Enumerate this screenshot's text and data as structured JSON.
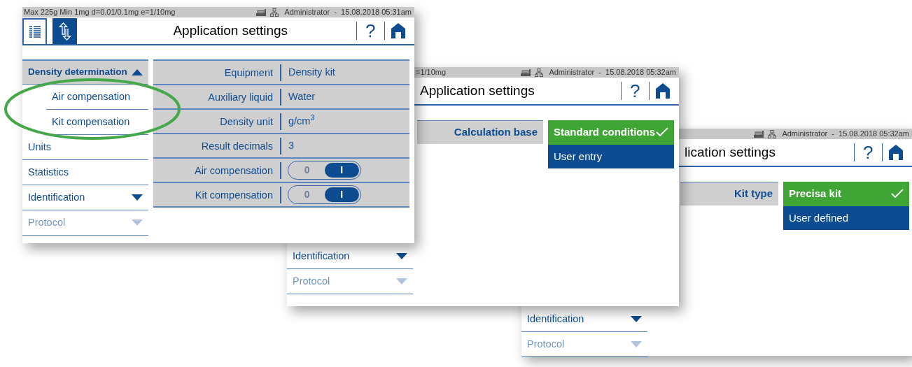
{
  "windows": [
    {
      "status_bar": {
        "scale_info": "Max 225g  Min 1mg  d=0.01/0.1mg  e=1/10mg",
        "user": "Administrator  -  15.08.2018 05:31am"
      },
      "header": {
        "tabs": [
          {
            "kind": "list",
            "selected": true
          },
          {
            "kind": "transfer",
            "selected": false
          }
        ],
        "title": "Application settings",
        "help": "?"
      },
      "sidebar": [
        {
          "label": "Density determination",
          "kind": "group",
          "selected": true,
          "expanded": true,
          "children": [
            {
              "label": "Air compensation"
            },
            {
              "label": "Kit compensation"
            }
          ]
        },
        {
          "label": "Units",
          "kind": "item",
          "selected": false
        },
        {
          "label": "Statistics",
          "kind": "item",
          "selected": false
        },
        {
          "label": "Identification",
          "kind": "group",
          "selected": false,
          "expanded": false
        },
        {
          "label": "Protocol",
          "kind": "group",
          "selected": false,
          "expanded": false,
          "faded": true
        }
      ],
      "body": {
        "kind": "table",
        "rows": [
          {
            "label": "Equipment",
            "kind": "value",
            "value": "Density kit"
          },
          {
            "label": "Auxiliary liquid",
            "kind": "value",
            "value": "Water"
          },
          {
            "label": "Density unit",
            "kind": "value",
            "value": "g/cm$^{3}$"
          },
          {
            "label": "Result decimals",
            "kind": "value",
            "value": "3"
          },
          {
            "label": "Air compensation",
            "kind": "toggle",
            "off_label": "0",
            "on_label": "I",
            "on": true
          },
          {
            "label": "Kit compensation",
            "kind": "toggle",
            "off_label": "0",
            "on_label": "I",
            "on": true
          }
        ]
      },
      "annotation": {
        "kind": "ellipse"
      }
    },
    {
      "status_bar": {
        "scale_info": "=1/10mg",
        "user": "Administrator  -  15.08.2018 05:32am"
      },
      "header": {
        "title": "Application settings",
        "help": "?"
      },
      "sidebar": [
        {
          "label": "Identification",
          "kind": "group",
          "selected": false,
          "expanded": false
        },
        {
          "label": "Protocol",
          "kind": "group",
          "selected": false,
          "expanded": false,
          "faded": true
        }
      ],
      "body": {
        "kind": "choice",
        "label": "Calculation base",
        "options": [
          {
            "label": "Standard conditions",
            "selected": true
          },
          {
            "label": "User entry",
            "selected": false
          }
        ]
      }
    },
    {
      "status_bar": {
        "user": "Administrator  -  15.08.2018 05:32am"
      },
      "header": {
        "title": "lication settings",
        "help": "?"
      },
      "sidebar": [
        {
          "label": "Identification",
          "kind": "group",
          "selected": false,
          "expanded": false
        },
        {
          "label": "Protocol",
          "kind": "group",
          "selected": false,
          "expanded": false,
          "faded": true
        }
      ],
      "body": {
        "kind": "choice",
        "label": "Kit type",
        "options": [
          {
            "label": "Precisa kit",
            "selected": true
          },
          {
            "label": "User defined",
            "selected": false
          }
        ]
      }
    }
  ]
}
